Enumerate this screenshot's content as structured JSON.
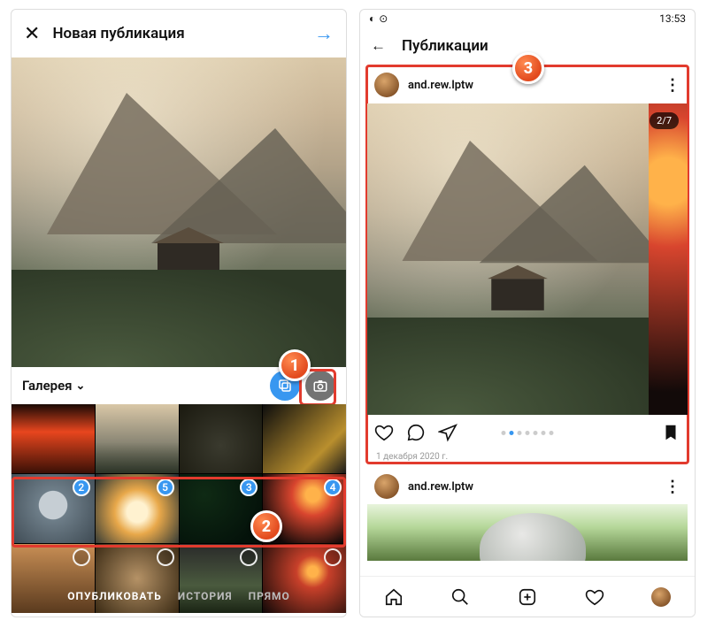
{
  "callouts": {
    "one": "1",
    "two": "2",
    "three": "3"
  },
  "left": {
    "header": {
      "title": "Новая публикация"
    },
    "gallery_label": "Галерея",
    "selection": {
      "row2": {
        "a": "2",
        "b": "5",
        "c": "3",
        "d": "4"
      }
    },
    "tabs": {
      "publish": "ОПУБЛИКОВАТЬ",
      "story": "ИСТОРИЯ",
      "live": "ПРЯМО"
    }
  },
  "right": {
    "status": {
      "time": "13:53"
    },
    "header": {
      "title": "Публикации"
    },
    "post": {
      "username": "and.rew.lptw",
      "carousel": "2/7",
      "date": "1 декабря 2020 г."
    },
    "next_post": {
      "username": "and.rew.lptw"
    }
  }
}
